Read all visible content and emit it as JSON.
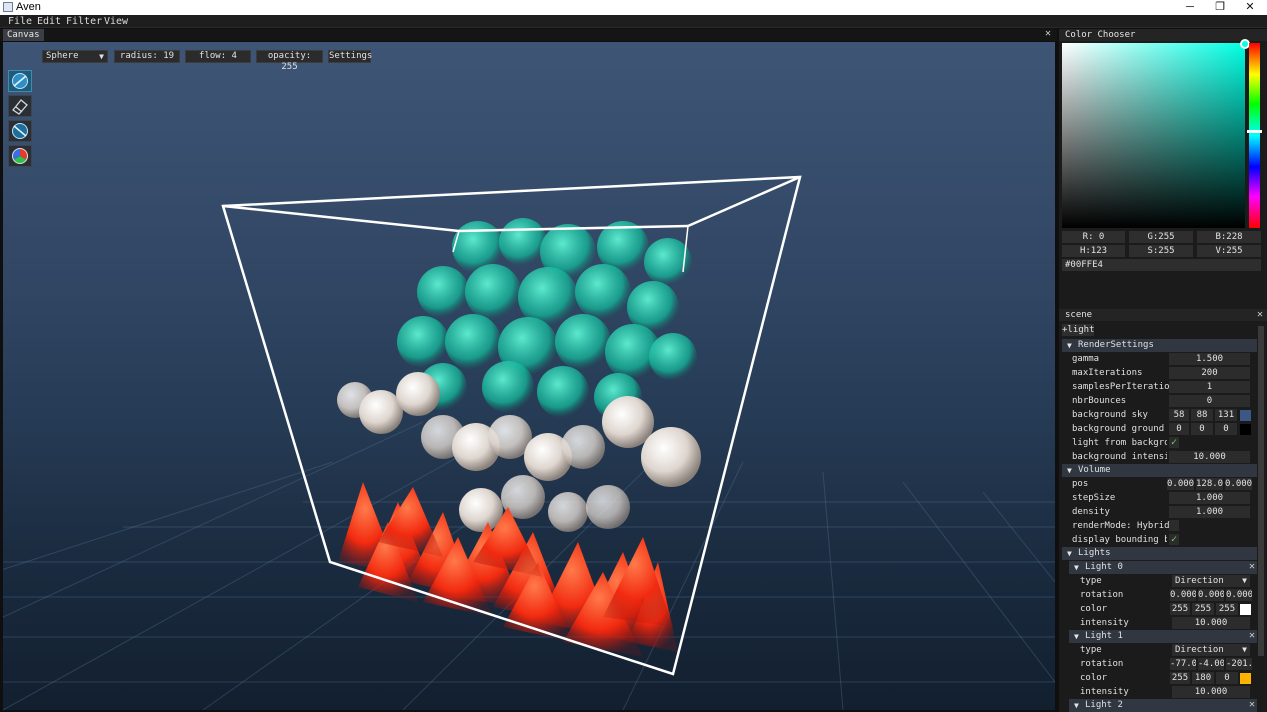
{
  "app": {
    "title": "Aven",
    "minimize_glyph": "─",
    "maximize_glyph": "❐",
    "close_glyph": "✕"
  },
  "menu": [
    "File",
    "Edit",
    "Filter",
    "View"
  ],
  "canvas": {
    "tab_label": "Canvas",
    "close_glyph": "✕",
    "toolbar": {
      "brush_shape": "Sphere",
      "dropdown_arrow": "▼",
      "radius": "radius: 19",
      "flow": "flow: 4",
      "opacity": "opacity: 255",
      "settings": "Settings"
    },
    "tools": [
      "brush-tool-icon",
      "eraser-tool-icon",
      "smudge-tool-icon",
      "color-picker-tool-icon"
    ]
  },
  "color_chooser": {
    "title": "Color Chooser",
    "selected_color": "#00ffe4",
    "r": "R:  0",
    "g": "G:255",
    "b": "B:228",
    "h": "H:123",
    "s": "S:255",
    "v": "V:255",
    "hex": "#00FFE4"
  },
  "scene": {
    "title": "scene",
    "close_glyph": "✕",
    "add_light": "+light",
    "render_settings": {
      "header": "RenderSettings",
      "arrow": "▼",
      "gamma_label": "gamma",
      "gamma": "1.500",
      "max_iterations_label": "maxIterations",
      "max_iterations": "200",
      "samples_label": "samplesPerIteration",
      "samples": "1",
      "bounces_label": "nbrBounces",
      "bounces": "0",
      "sky_label": "background sky",
      "sky_r": "58",
      "sky_g": "88",
      "sky_b": "131",
      "sky_color": "#3a5883",
      "ground_label": "background ground",
      "ground_r": "0",
      "ground_g": "0",
      "ground_b": "0",
      "ground_color": "#000000",
      "light_from_bg_label": "light from backgrou",
      "light_from_bg_check": "✓",
      "bg_intensity_label": "background intensi",
      "bg_intensity": "10.000"
    },
    "volume": {
      "header": "Volume",
      "arrow": "▼",
      "pos_label": "pos",
      "pos_x": "0.000",
      "pos_y": "128.0(",
      "pos_z": "0.000",
      "step_label": "stepSize",
      "step": "1.000",
      "density_label": "density",
      "density": "1.000",
      "render_mode_label": "renderMode: Hybrid",
      "bbox_label": "display bounding bo",
      "bbox_check": "✓"
    },
    "lights": {
      "header": "Lights",
      "arrow": "▼",
      "items": [
        {
          "header": "Light 0",
          "type_label": "type",
          "type": "Direction",
          "rotation_label": "rotation",
          "rot_x": "0.000",
          "rot_y": "0.000",
          "rot_z": "0.000",
          "color_label": "color",
          "r": "255",
          "g": "255",
          "b": "255",
          "color": "#ffffff",
          "intensity_label": "intensity",
          "intensity": "10.000"
        },
        {
          "header": "Light 1",
          "type_label": "type",
          "type": "Direction",
          "rotation_label": "rotation",
          "rot_x": "-77.0(",
          "rot_y": "-4.000",
          "rot_z": "-201.(",
          "color_label": "color",
          "r": "255",
          "g": "180",
          "b": "0",
          "color": "#ffb400",
          "intensity_label": "intensity",
          "intensity": "10.000"
        },
        {
          "header": "Light 2"
        }
      ]
    }
  }
}
